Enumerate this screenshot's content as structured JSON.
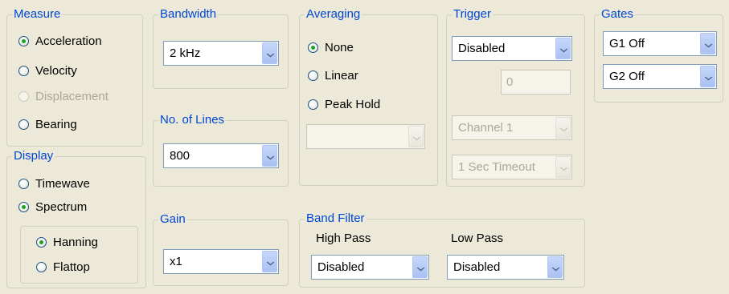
{
  "measure": {
    "title": "Measure",
    "options": [
      "Acceleration",
      "Velocity",
      "Displacement",
      "Bearing"
    ]
  },
  "display": {
    "title": "Display",
    "options": [
      "Timewave",
      "Spectrum"
    ],
    "window_options": [
      "Hanning",
      "Flattop"
    ]
  },
  "bandwidth": {
    "title": "Bandwidth",
    "value": "2 kHz"
  },
  "lines": {
    "title": "No. of Lines",
    "value": "800"
  },
  "gain": {
    "title": "Gain",
    "value": "x1"
  },
  "averaging": {
    "title": "Averaging",
    "options": [
      "None",
      "Linear",
      "Peak Hold"
    ],
    "value": ""
  },
  "band_filter": {
    "title": "Band Filter",
    "high_pass_label": "High Pass",
    "high_pass_value": "Disabled",
    "low_pass_label": "Low Pass",
    "low_pass_value": "Disabled"
  },
  "trigger": {
    "title": "Trigger",
    "mode": "Disabled",
    "level": "0",
    "channel": "Channel 1",
    "timeout": "1 Sec Timeout"
  },
  "gates": {
    "title": "Gates",
    "g1": "G1 Off",
    "g2": "G2 Off"
  }
}
